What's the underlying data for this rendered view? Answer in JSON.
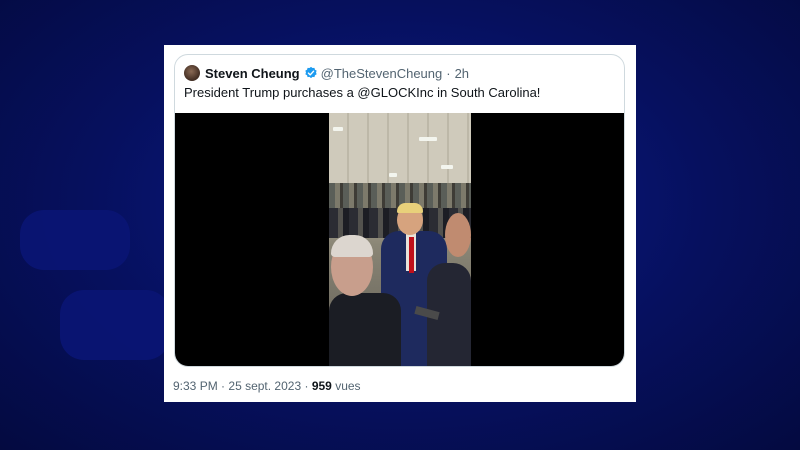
{
  "background": {
    "color": "#06105e"
  },
  "tweet": {
    "author_name": "Steven Cheung",
    "verified": true,
    "handle": "@TheStevenCheung",
    "separator": "·",
    "relative_time": "2h",
    "text": "President Trump purchases a @GLOCKInc in South Carolina!",
    "media": {
      "type": "video"
    },
    "footer": {
      "time": "9:33 PM",
      "date": "25 sept. 2023",
      "views_count": "959",
      "views_label": "vues"
    }
  },
  "colors": {
    "verified_blue": "#1d9bf0",
    "text_primary": "#0f1419",
    "text_secondary": "#536471"
  },
  "icons": {
    "verified": "verified-badge-icon"
  }
}
